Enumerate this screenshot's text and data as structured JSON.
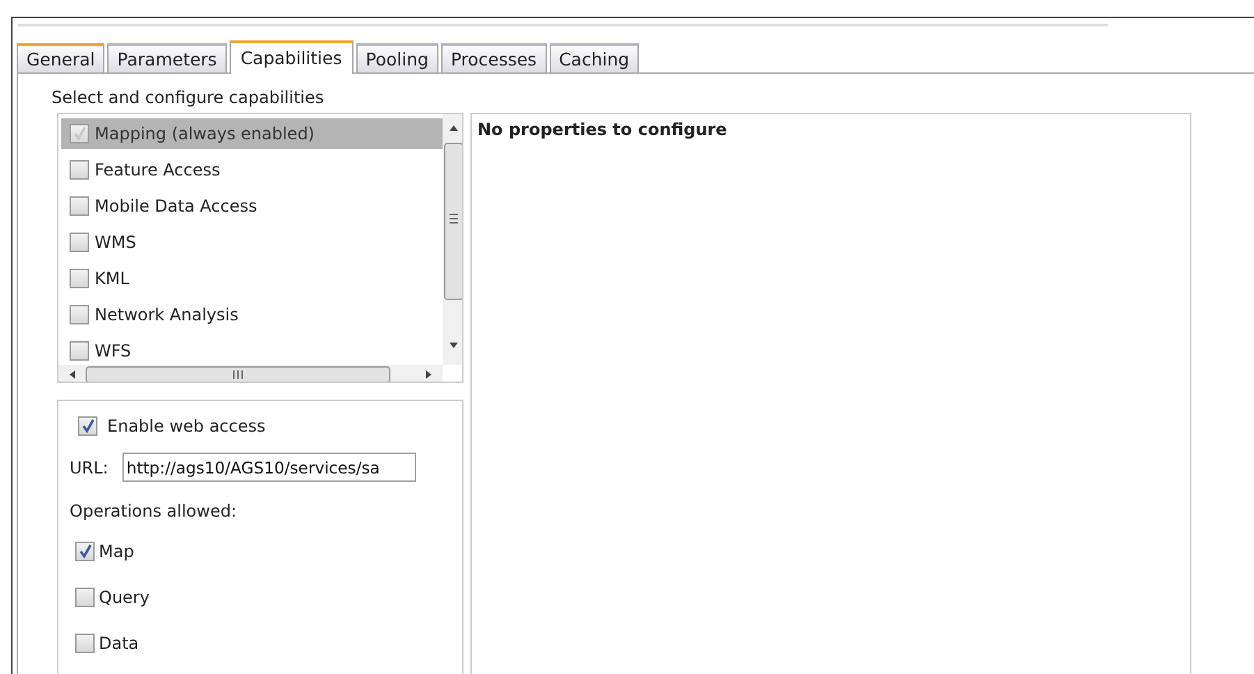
{
  "tabs": [
    {
      "label": "General",
      "selected": false,
      "focused": true
    },
    {
      "label": "Parameters",
      "selected": false,
      "focused": false
    },
    {
      "label": "Capabilities",
      "selected": true,
      "focused": false
    },
    {
      "label": "Pooling",
      "selected": false,
      "focused": false
    },
    {
      "label": "Processes",
      "selected": false,
      "focused": false
    },
    {
      "label": "Caching",
      "selected": false,
      "focused": false
    }
  ],
  "capabilities": {
    "heading": "Select and configure capabilities",
    "items": [
      {
        "label": "Mapping (always enabled)",
        "checked": true,
        "disabled": true,
        "selected": true
      },
      {
        "label": "Feature Access",
        "checked": false,
        "disabled": false,
        "selected": false
      },
      {
        "label": "Mobile Data Access",
        "checked": false,
        "disabled": false,
        "selected": false
      },
      {
        "label": "WMS",
        "checked": false,
        "disabled": false,
        "selected": false
      },
      {
        "label": "KML",
        "checked": false,
        "disabled": false,
        "selected": false
      },
      {
        "label": "Network Analysis",
        "checked": false,
        "disabled": false,
        "selected": false
      },
      {
        "label": "WFS",
        "checked": false,
        "disabled": false,
        "selected": false
      }
    ]
  },
  "properties": {
    "message": "No properties to configure"
  },
  "web_access": {
    "enable": {
      "label": "Enable web access",
      "checked": true
    },
    "url": {
      "label": "URL:",
      "value": "http://ags10/AGS10/services/sa"
    },
    "operations_heading": "Operations allowed:",
    "operations": [
      {
        "label": "Map",
        "checked": true
      },
      {
        "label": "Query",
        "checked": false
      },
      {
        "label": "Data",
        "checked": false
      }
    ]
  }
}
